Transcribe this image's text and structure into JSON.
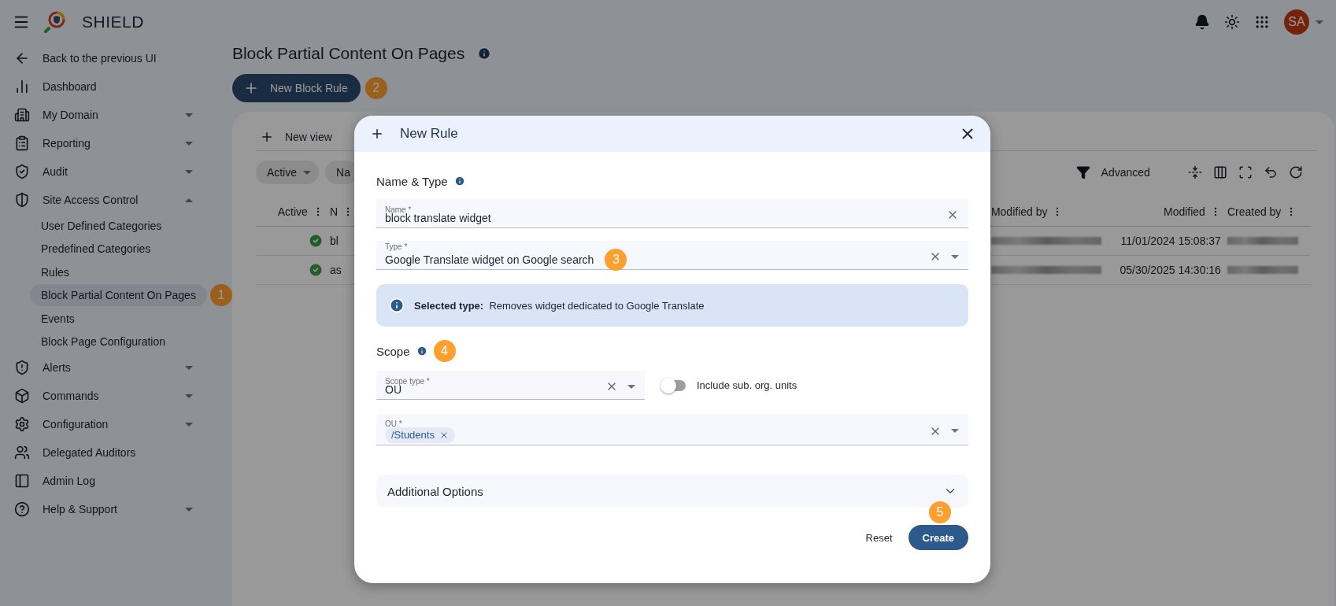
{
  "app": {
    "title": "SHIELD",
    "avatar": "SA"
  },
  "sidebar": {
    "items": [
      {
        "kind": "link",
        "label": "Back to the previous UI"
      },
      {
        "kind": "link",
        "label": "Dashboard"
      },
      {
        "kind": "group",
        "label": "My Domain",
        "expanded": false
      },
      {
        "kind": "group",
        "label": "Reporting",
        "expanded": false
      },
      {
        "kind": "group",
        "label": "Audit",
        "expanded": false
      },
      {
        "kind": "group",
        "label": "Site Access Control",
        "expanded": true,
        "children": [
          {
            "label": "User Defined Categories",
            "selected": false
          },
          {
            "label": "Predefined Categories",
            "selected": false
          },
          {
            "label": "Rules",
            "selected": false
          },
          {
            "label": "Block Partial Content On Pages",
            "selected": true,
            "marker": "1"
          },
          {
            "label": "Events",
            "selected": false
          },
          {
            "label": "Block Page Configuration",
            "selected": false
          }
        ]
      },
      {
        "kind": "group",
        "label": "Alerts",
        "expanded": false
      },
      {
        "kind": "group",
        "label": "Commands",
        "expanded": false
      },
      {
        "kind": "group",
        "label": "Configuration",
        "expanded": false
      },
      {
        "kind": "link",
        "label": "Delegated Auditors"
      },
      {
        "kind": "link",
        "label": "Admin Log"
      },
      {
        "kind": "group",
        "label": "Help & Support",
        "expanded": false
      }
    ]
  },
  "page": {
    "title": "Block Partial Content On Pages",
    "new_button": {
      "label": "New Block Rule",
      "marker": "2"
    }
  },
  "table_panel": {
    "new_view": "New view",
    "filters": [
      "Active",
      "Na"
    ],
    "advanced": "Advanced",
    "columns": [
      "Active",
      "N",
      "Modified by",
      "Modified",
      "Created by"
    ],
    "rows": [
      {
        "active": true,
        "name": "bl",
        "modified": "11/01/2024 15:08:37"
      },
      {
        "active": true,
        "name": "as",
        "modified": "05/30/2025 14:30:16"
      }
    ]
  },
  "dialog": {
    "title": "New Rule",
    "name_type_heading": "Name & Type",
    "name_field": {
      "label": "Name *",
      "value": "block translate widget"
    },
    "type_field": {
      "label": "Type *",
      "value": "Google Translate widget on Google search",
      "marker": "3"
    },
    "info": {
      "prefix": "Selected type:",
      "text": "Removes widget dedicated to Google Translate"
    },
    "scope_heading": "Scope",
    "scope_marker": "4",
    "scope_type_field": {
      "label": "Scope type *",
      "value": "OU"
    },
    "include_sub": {
      "label": "Include sub. org. units",
      "on": false
    },
    "ou_field": {
      "label": "OU *",
      "chips": [
        "/Students"
      ]
    },
    "additional_options": {
      "label": "Additional Options",
      "expanded": false
    },
    "reset": "Reset",
    "create": "Create",
    "create_marker": "5"
  }
}
